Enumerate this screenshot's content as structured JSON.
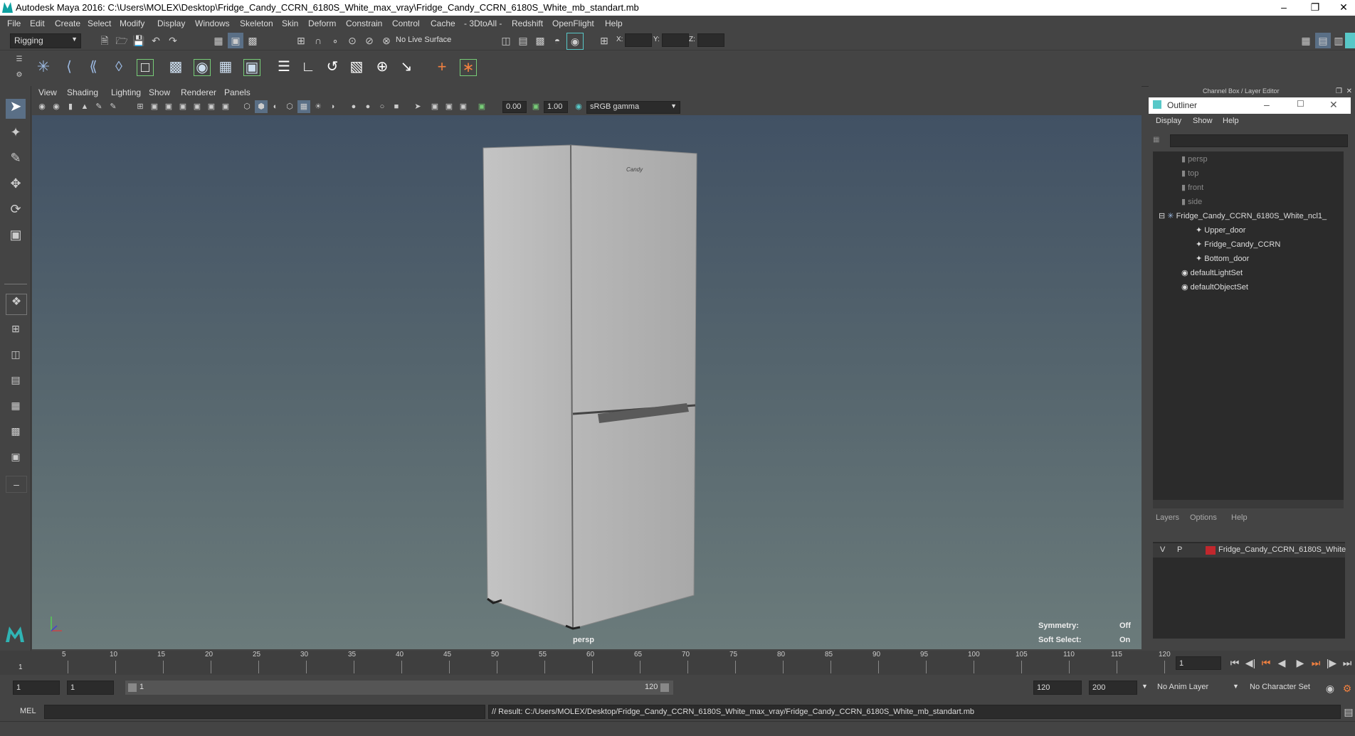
{
  "title_bar": {
    "title": "Autodesk Maya 2016: C:\\Users\\MOLEX\\Desktop\\Fridge_Candy_CCRN_6180S_White_max_vray\\Fridge_Candy_CCRN_6180S_White_mb_standart.mb"
  },
  "menu": [
    "File",
    "Edit",
    "Create",
    "Select",
    "Modify",
    "Display",
    "Windows",
    "Skeleton",
    "Skin",
    "Deform",
    "Constrain",
    "Control",
    "Cache",
    "- 3DtoAll -",
    "Redshift",
    "OpenFlight",
    "Help"
  ],
  "toolbar": {
    "mode": "Rigging",
    "live_surface": "No Live Surface",
    "x_label": "X:",
    "y_label": "Y:",
    "z_label": "Z:"
  },
  "panel_menu": [
    "View",
    "Shading",
    "Lighting",
    "Show",
    "Renderer",
    "Panels"
  ],
  "panel_toolbar": {
    "exposure": "0.00",
    "gamma": "1.00",
    "color_space": "sRGB gamma"
  },
  "viewport": {
    "camera": "persp",
    "symmetry_label": "Symmetry:",
    "symmetry_value": "Off",
    "soft_select_label": "Soft Select:",
    "soft_select_value": "On",
    "brand": "Candy"
  },
  "channel_box": {
    "title": "Channel Box / Layer Editor"
  },
  "outliner": {
    "title": "Outliner",
    "menu": [
      "Display",
      "Show",
      "Help"
    ],
    "items": [
      {
        "label": "persp",
        "dim": true
      },
      {
        "label": "top",
        "dim": true
      },
      {
        "label": "front",
        "dim": true
      },
      {
        "label": "side",
        "dim": true
      },
      {
        "label": "Fridge_Candy_CCRN_6180S_White_ncl1_",
        "dim": false
      },
      {
        "label": "Upper_door",
        "dim": false
      },
      {
        "label": "Fridge_Candy_CCRN",
        "dim": false
      },
      {
        "label": "Bottom_door",
        "dim": false
      },
      {
        "label": "defaultLightSet",
        "dim": false
      },
      {
        "label": "defaultObjectSet",
        "dim": false
      }
    ]
  },
  "layers": {
    "menu": [
      "Layers",
      "Options",
      "Help"
    ],
    "v": "V",
    "p": "P",
    "layer_name": "Fridge_Candy_CCRN_6180S_White",
    "layer_color": "#c1272d"
  },
  "timeline": {
    "ticks": [
      "5",
      "10",
      "15",
      "20",
      "25",
      "30",
      "35",
      "40",
      "45",
      "50",
      "55",
      "60",
      "65",
      "70",
      "75",
      "80",
      "85",
      "90",
      "95",
      "100",
      "105",
      "110",
      "115",
      "120"
    ],
    "start_marker": "1",
    "current_frame": "1"
  },
  "range": {
    "start": "1",
    "playback_start": "1",
    "slider_start": "1",
    "slider_end": "120",
    "playback_end": "120",
    "end": "200",
    "anim_layer": "No Anim Layer",
    "char_set": "No Character Set"
  },
  "command": {
    "lang": "MEL",
    "result": "// Result: C:/Users/MOLEX/Desktop/Fridge_Candy_CCRN_6180S_White_max_vray/Fridge_Candy_CCRN_6180S_White_mb_standart.mb"
  },
  "colors": {
    "accent": "#58c8c8",
    "viewport_top": "#415164",
    "viewport_bottom": "#6b7b7b"
  }
}
